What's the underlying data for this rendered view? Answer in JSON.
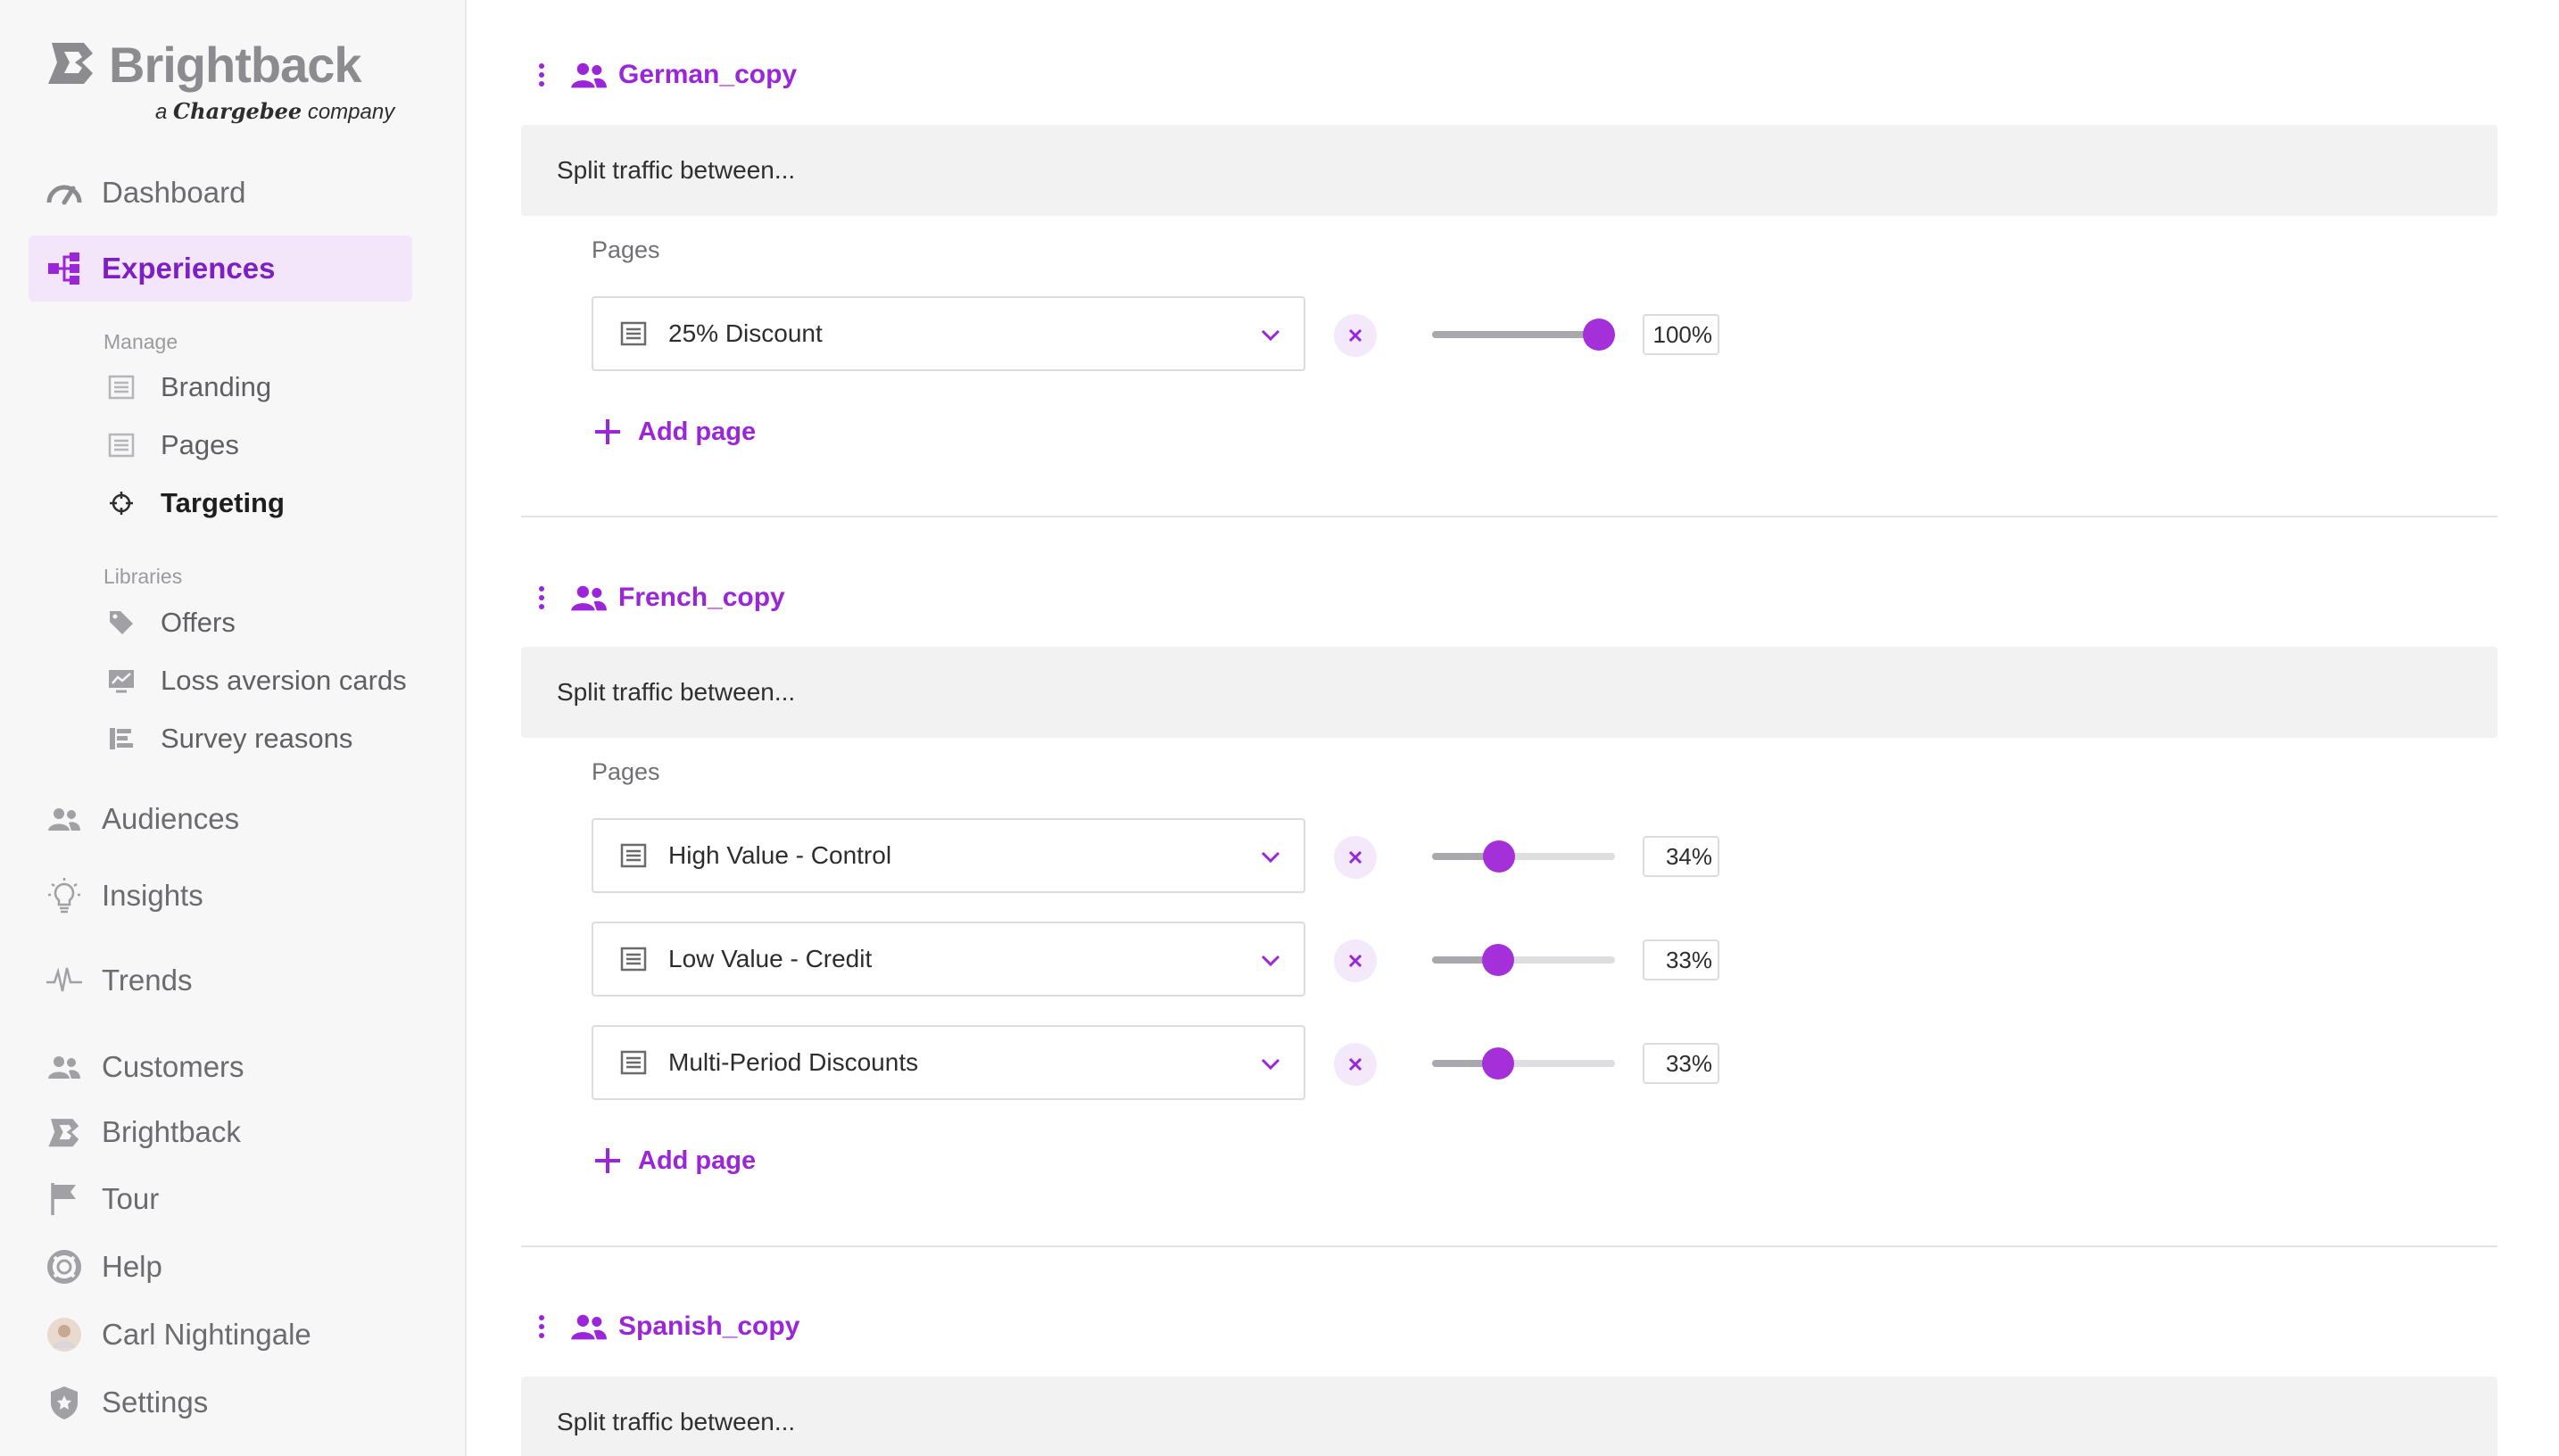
{
  "brand": {
    "name": "Brightback",
    "tagline_prefix": "a",
    "tagline_brand": "Chargebee",
    "tagline_suffix": "company"
  },
  "nav": {
    "dashboard": "Dashboard",
    "experiences": "Experiences",
    "manage_label": "Manage",
    "branding": "Branding",
    "pages": "Pages",
    "targeting": "Targeting",
    "libraries_label": "Libraries",
    "offers": "Offers",
    "loss_aversion_cards": "Loss aversion cards",
    "survey_reasons": "Survey reasons",
    "audiences": "Audiences",
    "insights": "Insights",
    "trends": "Trends",
    "customers": "Customers",
    "brightback": "Brightback",
    "tour": "Tour",
    "help": "Help",
    "user": "Carl Nightingale",
    "settings": "Settings"
  },
  "groups": [
    {
      "name": "German_copy",
      "split_label": "Split traffic between...",
      "pages_label": "Pages",
      "pages": [
        {
          "name": "25% Discount",
          "percent": 100,
          "percent_label": "100%"
        }
      ],
      "add_page_label": "Add page"
    },
    {
      "name": "French_copy",
      "split_label": "Split traffic between...",
      "pages_label": "Pages",
      "pages": [
        {
          "name": "High Value - Control",
          "percent": 34,
          "percent_label": "34%"
        },
        {
          "name": "Low Value - Credit",
          "percent": 33,
          "percent_label": "33%"
        },
        {
          "name": "Multi-Period Discounts",
          "percent": 33,
          "percent_label": "33%"
        }
      ],
      "add_page_label": "Add page"
    },
    {
      "name": "Spanish_copy",
      "split_label": "Split traffic between..."
    }
  ],
  "colors": {
    "accent": "#9b26d9",
    "accent_bg": "#f3e6fb",
    "slider_thumb": "#a52fd8"
  }
}
